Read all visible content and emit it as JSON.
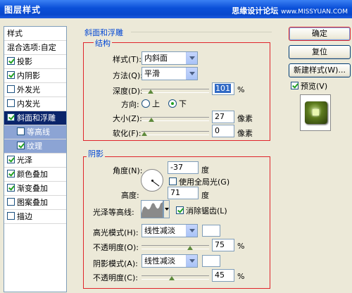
{
  "window": {
    "title": "图层样式",
    "watermark": "思缘设计论坛",
    "watermark_url": "www.MISSYUAN.COM"
  },
  "sidebar": {
    "header": "样式",
    "items": [
      {
        "label": "混合选项:自定",
        "checkbox": false,
        "has_checkbox": false
      },
      {
        "label": "投影",
        "checked": true
      },
      {
        "label": "内阴影",
        "checked": true
      },
      {
        "label": "外发光",
        "checked": false
      },
      {
        "label": "内发光",
        "checked": false
      },
      {
        "label": "斜面和浮雕",
        "checked": true,
        "selected": true
      },
      {
        "label": "等高线",
        "checked": false,
        "sub": true
      },
      {
        "label": "纹理",
        "checked": true,
        "sub": true
      },
      {
        "label": "光泽",
        "checked": true
      },
      {
        "label": "颜色叠加",
        "checked": true
      },
      {
        "label": "渐变叠加",
        "checked": true
      },
      {
        "label": "图案叠加",
        "checked": false
      },
      {
        "label": "描边",
        "checked": false
      }
    ]
  },
  "bevel": {
    "group_title": "斜面和浮雕",
    "structure_title": "结构",
    "style_label": "样式(T):",
    "style_value": "内斜面",
    "technique_label": "方法(Q):",
    "technique_value": "平滑",
    "depth_label": "深度(D):",
    "depth_value": "101",
    "depth_unit": "%",
    "depth_fraction": 0.1,
    "direction_label": "方向:",
    "direction_up": "上",
    "direction_down": "下",
    "size_label": "大小(Z):",
    "size_value": "27",
    "size_unit": "像素",
    "size_fraction": 0.11,
    "soften_label": "软化(F):",
    "soften_value": "0",
    "soften_unit": "像素",
    "soften_fraction": 0.0
  },
  "shading": {
    "title": "阴影",
    "angle_label": "角度(N):",
    "angle_value": "-37",
    "angle_unit": "度",
    "global_light_label": "使用全局光(G)",
    "altitude_label": "高度:",
    "altitude_value": "71",
    "altitude_unit": "度",
    "gloss_contour_label": "光泽等高线:",
    "antialias_label": "消除锯齿(L)",
    "highlight_mode_label": "高光模式(H):",
    "highlight_mode_value": "线性减淡",
    "highlight_opacity_label": "不透明度(O):",
    "highlight_opacity_value": "75",
    "highlight_opacity_unit": "%",
    "highlight_opacity_fraction": 0.75,
    "shadow_mode_label": "阴影模式(A):",
    "shadow_mode_value": "线性减淡",
    "shadow_opacity_label": "不透明度(C):",
    "shadow_opacity_value": "45",
    "shadow_opacity_unit": "%",
    "shadow_opacity_fraction": 0.45
  },
  "buttons": {
    "ok": "确定",
    "reset": "复位",
    "new_style": "新建样式(W)...",
    "preview": "预览(V)"
  },
  "colors": {
    "accent": "#0046d5",
    "highlight_box": "#e0242b",
    "selection": "#0a246a"
  }
}
